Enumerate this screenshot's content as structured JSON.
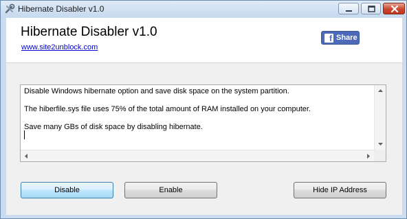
{
  "window": {
    "title": "Hibernate Disabler v1.0",
    "icon": "tools-icon",
    "controls": [
      "minimize-icon",
      "maximize-icon",
      "close-icon"
    ]
  },
  "header": {
    "app_title": "Hibernate Disabler v1.0",
    "link_text": "www.site2unblock.com",
    "share_label": "Share",
    "share_icon": "facebook-icon"
  },
  "info": {
    "line1": "Disable Windows hibernate option and save disk space on the system partition.",
    "line2": "The hiberfile.sys file uses 75% of the total amount of RAM installed on your computer.",
    "line3": "Save many GBs of disk space by disabling hibernate."
  },
  "buttons": {
    "disable": "Disable",
    "enable": "Enable",
    "hide_ip": "Hide IP Address"
  },
  "colors": {
    "facebook": "#4c69ba",
    "link": "#0000cc",
    "close_button": "#c9462c",
    "default_button": "#bee6fd"
  }
}
